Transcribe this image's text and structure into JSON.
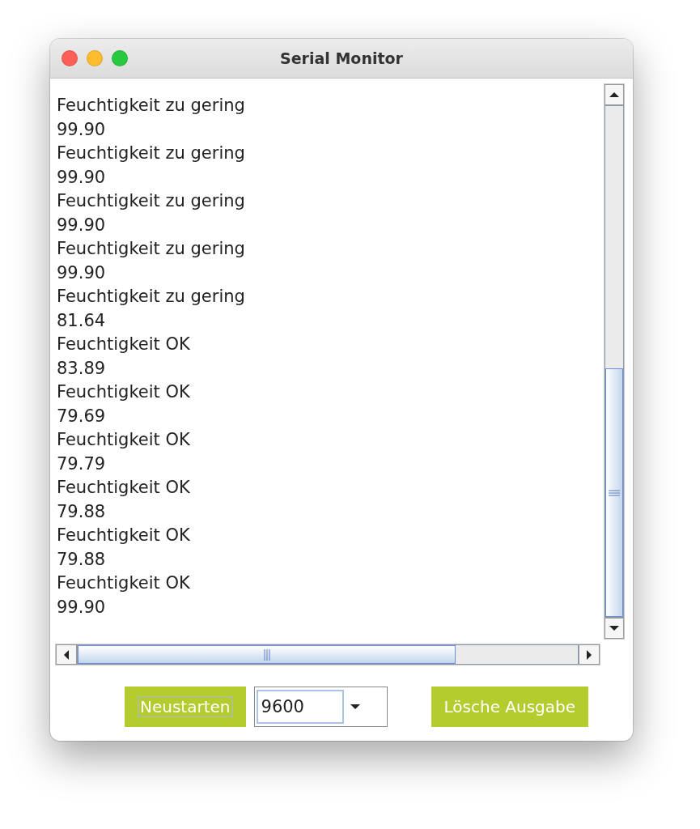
{
  "window": {
    "title": "Serial Monitor"
  },
  "output_lines": [
    "Feuchtigkeit zu gering",
    "99.90",
    "Feuchtigkeit zu gering",
    "99.90",
    "Feuchtigkeit zu gering",
    "99.90",
    "Feuchtigkeit zu gering",
    "99.90",
    "Feuchtigkeit zu gering",
    "81.64",
    "Feuchtigkeit OK",
    "83.89",
    "Feuchtigkeit OK",
    "79.69",
    "Feuchtigkeit OK",
    "79.79",
    "Feuchtigkeit OK",
    "79.88",
    "Feuchtigkeit OK",
    "79.88",
    "Feuchtigkeit OK",
    "99.90"
  ],
  "restart_button": "Neustarten",
  "baud_select": {
    "value": "9600"
  },
  "clear_button": "Lösche Ausgabe"
}
